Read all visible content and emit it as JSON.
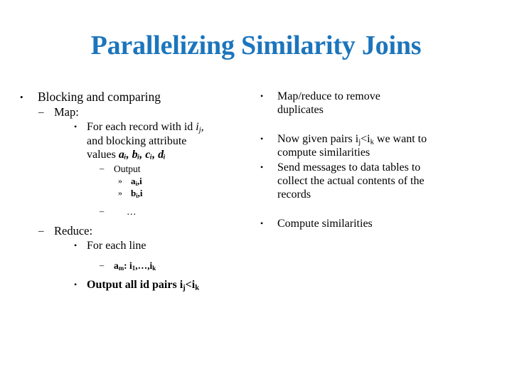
{
  "slide": {
    "title": "Parallelizing Similarity Joins",
    "title_color": "#1c75bc",
    "background_color": "#ffffff",
    "text_color": "#000000"
  },
  "bullets": {
    "bullet_dot": "•",
    "bullet_dash": "–",
    "bullet_chevron": "»"
  },
  "left_column": {
    "l1_blocking": "Blocking and comparing",
    "l2_map": "Map:",
    "l3_for_each_record_pre": "For each record with id ",
    "l3_for_each_record_var": "i",
    "l3_for_each_record_sub": "j",
    "l3_for_each_record_comma": ",",
    "l3_and_blocking": "and blocking attribute",
    "l3_values_pre": "values ",
    "l3_values_expr": "aᵢ, bᵢ, cᵢ, dᵢ",
    "l4_output": "Output",
    "l5_a_i": "a",
    "l5_a_i_sub": "i",
    "l5_a_i_tail": ",i",
    "l5_b_i": "b",
    "l5_b_i_sub": "i",
    "l5_b_i_tail": ",i",
    "l4_ellipsis": "…",
    "l2_reduce": "Reduce:",
    "l3_for_each_line": "For each line",
    "l4_am_a": "a",
    "l4_am_sub": "m",
    "l4_am_colon": ": i",
    "l4_am_sub1": "1",
    "l4_am_mid": ",…,i",
    "l4_am_subk": "k",
    "l3_output_pairs_pre": "Output all id pairs i",
    "l3_output_pairs_subj": "j",
    "l3_output_pairs_lt": "<i",
    "l3_output_pairs_subk": "k"
  },
  "right_column": {
    "r1_line1": "Map/reduce to remove",
    "r1_line2": "duplicates",
    "r2_pre": "Now given pairs i",
    "r2_subj": "j",
    "r2_mid": "<i",
    "r2_subk": "k",
    "r2_post": " we want to",
    "r2_line2": "compute similarities",
    "r3_line1": "Send messages to data tables to",
    "r3_line2": "collect the actual contents of the",
    "r3_line3": "records",
    "r4_line1": "Compute similarities"
  }
}
